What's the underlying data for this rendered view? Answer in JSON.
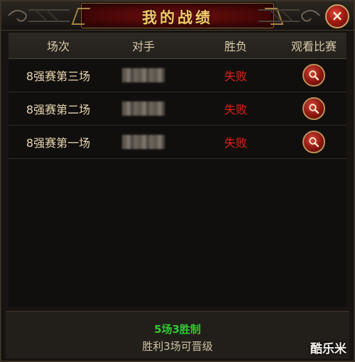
{
  "window": {
    "title": "我的战绩",
    "close_label": "×"
  },
  "table": {
    "columns": [
      "场次",
      "对手",
      "胜负",
      "观看比赛"
    ],
    "rows": [
      {
        "round": "8强赛第三场",
        "opponent": "",
        "result": "失败",
        "view_icon": "magnifier-icon"
      },
      {
        "round": "8强赛第二场",
        "opponent": "",
        "result": "失败",
        "view_icon": "magnifier-icon"
      },
      {
        "round": "8强赛第一场",
        "opponent": "",
        "result": "失败",
        "view_icon": "magnifier-icon"
      }
    ]
  },
  "footer": {
    "rule_main": "5场3胜制",
    "rule_sub": "胜利3场可晋级"
  },
  "watermark": "酷乐米",
  "colors": {
    "title_text": "#f2c86a",
    "loss": "#e0211a",
    "rule_highlight": "#2fc92f",
    "header_text": "#d7c9a8"
  }
}
